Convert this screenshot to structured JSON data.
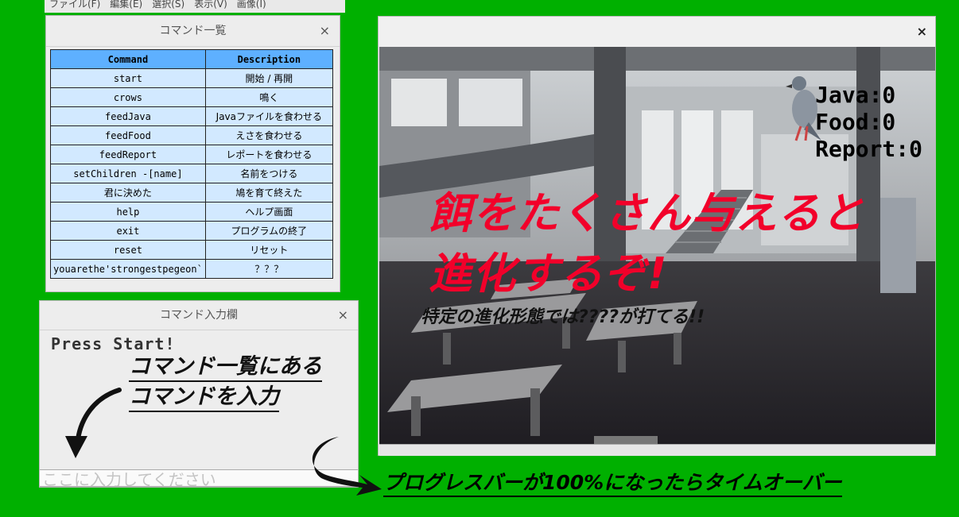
{
  "menubar_fragment": "ファイル(F)　編集(E)　選択(S)　表示(V)　画像(I)",
  "command_window": {
    "title": "コマンド一覧",
    "close_glyph": "×",
    "headers": [
      "Command",
      "Description"
    ],
    "rows": [
      [
        "start",
        "開始 / 再開"
      ],
      [
        "crows",
        "鳴く"
      ],
      [
        "feedJava",
        "Javaファイルを食わせる"
      ],
      [
        "feedFood",
        "えさを食わせる"
      ],
      [
        "feedReport",
        "レポートを食わせる"
      ],
      [
        "setChildren -[name]",
        "名前をつける"
      ],
      [
        "君に決めた",
        "鳩を育て終えた"
      ],
      [
        "help",
        "ヘルプ画面"
      ],
      [
        "exit",
        "プログラムの終了"
      ],
      [
        "reset",
        "リセット"
      ],
      [
        "youarethe'strongestpegeon`",
        "？？？"
      ]
    ],
    "colors": {
      "header": "#5eb0ff",
      "cell": "#d2e9ff"
    }
  },
  "input_window": {
    "title": "コマンド入力欄",
    "close_glyph": "×",
    "output_text": "Press Start!",
    "hint_line1": "コマンド一覧にある",
    "hint_line2": "コマンドを入力",
    "input_placeholder": "ここに入力してください"
  },
  "game_window": {
    "close_glyph": "×",
    "stats": {
      "java": "Java:0",
      "food": "Food:0",
      "report": "Report:0"
    },
    "headline_line1": "餌をたくさん与えると",
    "headline_line2": "進化するぞ!",
    "sub_text": "特定の進化形態では????が打てる!!",
    "progress_fraction": 0.0,
    "colors": {
      "headline": "#f2002a"
    }
  },
  "annotation": {
    "bottom_note": "プログレスバーが100%になったらタイムオーバー"
  },
  "colors": {
    "background": "#00b000"
  }
}
